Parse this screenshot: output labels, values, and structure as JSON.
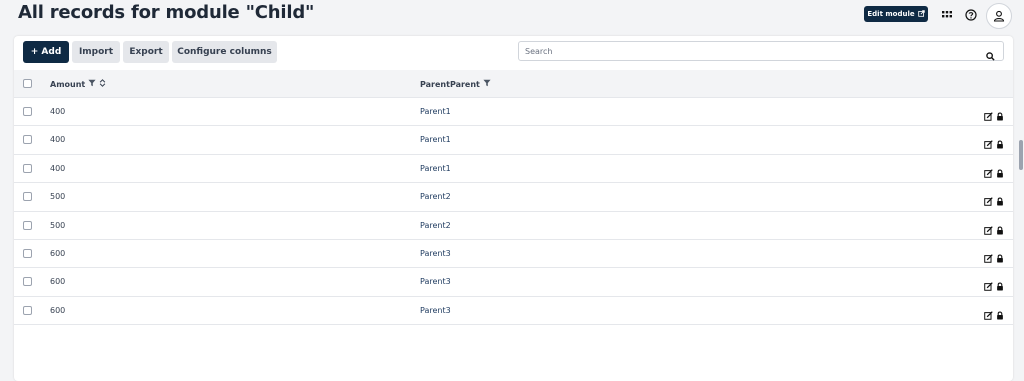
{
  "header": {
    "title": "All records for module \"Child\"",
    "edit_module_label": "Edit module",
    "icons": [
      "apps-grid-icon",
      "help-icon",
      "user-icon"
    ]
  },
  "toolbar": {
    "add_label": "+ Add",
    "import_label": "Import",
    "export_label": "Export",
    "configure_label": "Configure columns",
    "search_placeholder": "Search",
    "search_value": ""
  },
  "table": {
    "columns": [
      {
        "label": "Amount",
        "filter": true,
        "sort": true
      },
      {
        "label": "ParentParent",
        "filter": true,
        "sort": false
      }
    ],
    "rows": [
      {
        "amount": "400",
        "parent": "Parent1"
      },
      {
        "amount": "400",
        "parent": "Parent1"
      },
      {
        "amount": "400",
        "parent": "Parent1"
      },
      {
        "amount": "500",
        "parent": "Parent2"
      },
      {
        "amount": "500",
        "parent": "Parent2"
      },
      {
        "amount": "600",
        "parent": "Parent3"
      },
      {
        "amount": "600",
        "parent": "Parent3"
      },
      {
        "amount": "600",
        "parent": "Parent3"
      }
    ]
  },
  "colors": {
    "primary": "#0f2a44",
    "background": "#f3f4f6",
    "link": "#1e3a5f"
  }
}
